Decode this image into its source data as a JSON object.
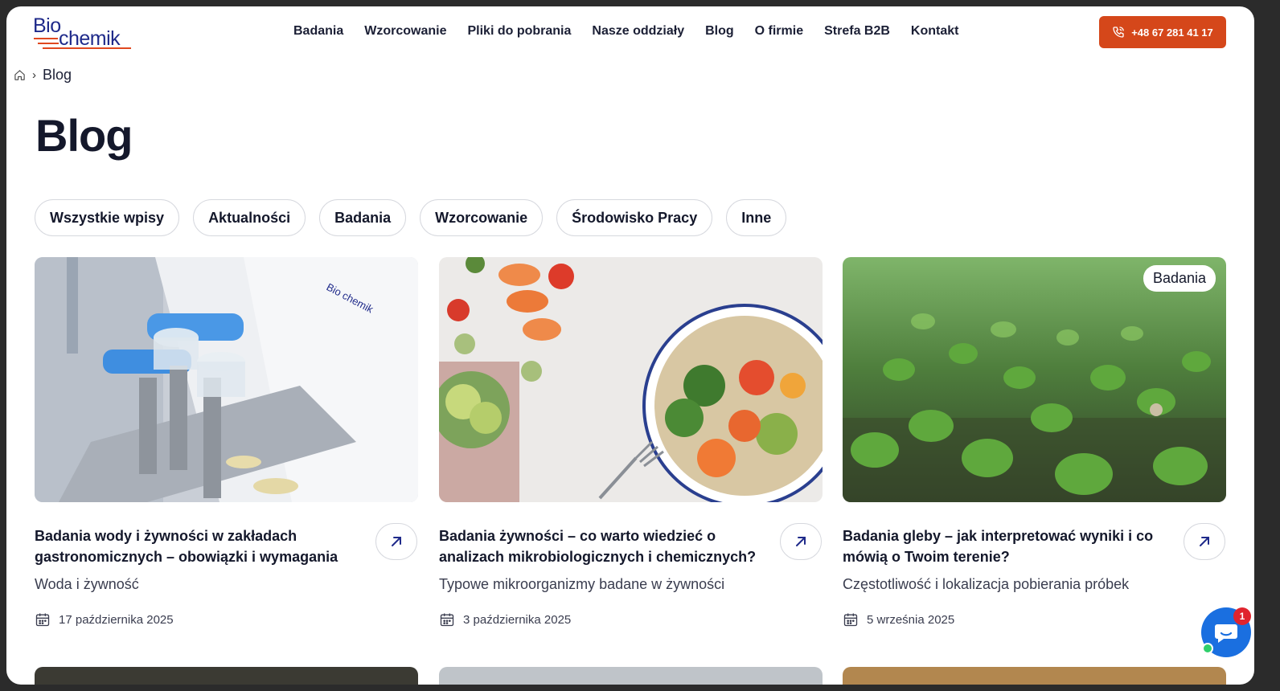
{
  "brand": {
    "part1": "Bio",
    "part2": "chemik",
    "primary_color": "#1f2a8a",
    "accent_color": "#e0481f"
  },
  "nav": {
    "items": [
      {
        "label": "Badania"
      },
      {
        "label": "Wzorcowanie"
      },
      {
        "label": "Pliki do pobrania"
      },
      {
        "label": "Nasze oddziały"
      },
      {
        "label": "Blog"
      },
      {
        "label": "O firmie"
      },
      {
        "label": "Strefa B2B"
      },
      {
        "label": "Kontakt"
      }
    ],
    "phone": "+48 67 281 41 17",
    "phone_icon": "phone-icon",
    "cta_color": "#d5471a"
  },
  "breadcrumb": {
    "home_icon": "home-icon",
    "current": "Blog"
  },
  "page": {
    "title": "Blog"
  },
  "filters": [
    {
      "label": "Wszystkie wpisy"
    },
    {
      "label": "Aktualności"
    },
    {
      "label": "Badania"
    },
    {
      "label": "Wzorcowanie"
    },
    {
      "label": "Środowisko Pracy"
    },
    {
      "label": "Inne"
    }
  ],
  "posts": [
    {
      "title": "Badania wody i żywności w zakładach gastronomicznych – obowiązki i wymagania",
      "subtitle": "Woda i żywność",
      "date": "17 października 2025",
      "badge": "",
      "image": "lab-filtration-photo"
    },
    {
      "title": "Badania żywności – co warto wiedzieć o analizach mikrobiologicznych i chemicznych?",
      "subtitle": "Typowe mikroorganizmy badane w żywności",
      "date": "3 października 2025",
      "badge": "",
      "image": "vegetable-bowl-photo"
    },
    {
      "title": "Badania gleby – jak interpretować wyniki i co mówią o Twoim terenie?",
      "subtitle": "Częstotliwość i lokalizacja pobierania próbek",
      "date": "5 września 2025",
      "badge": "Badania",
      "image": "seedlings-photo"
    }
  ],
  "chat": {
    "unread": "1",
    "icon": "chat-icon"
  }
}
